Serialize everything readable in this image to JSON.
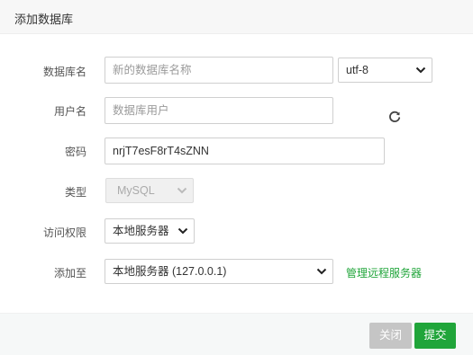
{
  "dialog": {
    "title": "添加数据库"
  },
  "form": {
    "db_name": {
      "label": "数据库名",
      "placeholder": "新的数据库名称"
    },
    "charset": {
      "value": "utf-8"
    },
    "username": {
      "label": "用户名",
      "placeholder": "数据库用户"
    },
    "password": {
      "label": "密码",
      "value": "nrjT7esF8rT4sZNN"
    },
    "type": {
      "label": "类型",
      "value": "MySQL"
    },
    "access": {
      "label": "访问权限",
      "value": "本地服务器"
    },
    "add_to": {
      "label": "添加至",
      "value": "本地服务器 (127.0.0.1)"
    },
    "manage_remote_link": "管理远程服务器"
  },
  "footer": {
    "close_label": "关闭",
    "submit_label": "提交"
  },
  "colors": {
    "accent": "#20a53a",
    "disabled_button": "#c5c5c5"
  },
  "icons": {
    "refresh": "refresh-icon",
    "dropdown": "chevron-down-icon"
  }
}
